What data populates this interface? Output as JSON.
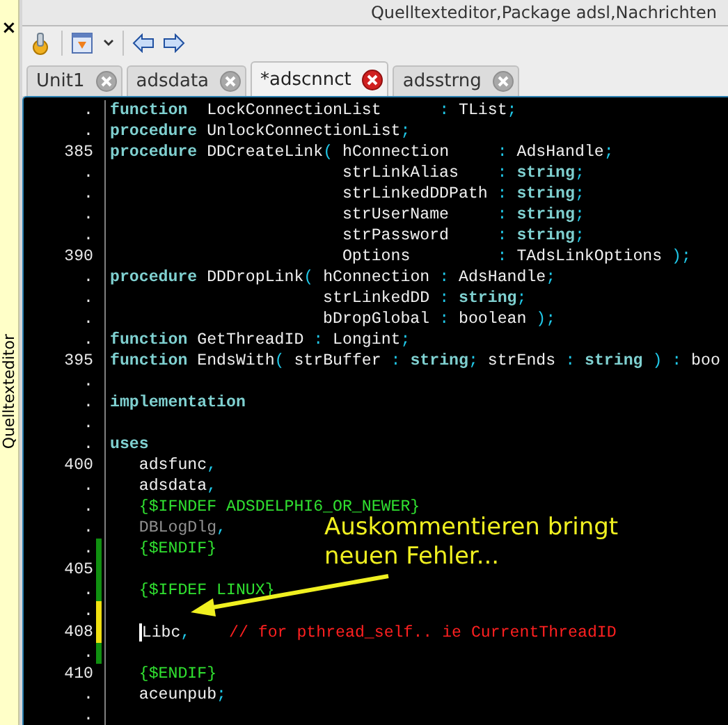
{
  "window": {
    "title": "Quelltexteditor,Package adsl,Nachrichten"
  },
  "dock": {
    "close": "×",
    "title": "Quelltexteditor"
  },
  "tabs": [
    {
      "label": "Unit1",
      "selected": false
    },
    {
      "label": "adsdata",
      "selected": false
    },
    {
      "label": "*adscnnct",
      "selected": true
    },
    {
      "label": "adsstrng",
      "selected": false
    }
  ],
  "code": {
    "lines": [
      {
        "number": ".",
        "tokens": [
          {
            "kind": "keyword",
            "text": "function"
          },
          {
            "kind": "text",
            "text": "  LockConnectionList      "
          },
          {
            "kind": "symbol",
            "text": ": "
          },
          {
            "kind": "text",
            "text": "TList"
          },
          {
            "kind": "symbol",
            "text": ";"
          }
        ]
      },
      {
        "number": ".",
        "tokens": [
          {
            "kind": "keyword",
            "text": "procedure"
          },
          {
            "kind": "text",
            "text": " UnlockConnectionList"
          },
          {
            "kind": "symbol",
            "text": ";"
          }
        ]
      },
      {
        "number": "385",
        "tokens": [
          {
            "kind": "keyword",
            "text": "procedure"
          },
          {
            "kind": "text",
            "text": " DDCreateLink"
          },
          {
            "kind": "symbol",
            "text": "("
          },
          {
            "kind": "text",
            "text": " hConnection     "
          },
          {
            "kind": "symbol",
            "text": ": "
          },
          {
            "kind": "text",
            "text": "AdsHandle"
          },
          {
            "kind": "symbol",
            "text": ";"
          }
        ]
      },
      {
        "number": ".",
        "tokens": [
          {
            "kind": "text",
            "text": "                        strLinkAlias    "
          },
          {
            "kind": "symbol",
            "text": ": "
          },
          {
            "kind": "keyword",
            "text": "string"
          },
          {
            "kind": "symbol",
            "text": ";"
          }
        ]
      },
      {
        "number": ".",
        "tokens": [
          {
            "kind": "text",
            "text": "                        strLinkedDDPath "
          },
          {
            "kind": "symbol",
            "text": ": "
          },
          {
            "kind": "keyword",
            "text": "string"
          },
          {
            "kind": "symbol",
            "text": ";"
          }
        ]
      },
      {
        "number": ".",
        "tokens": [
          {
            "kind": "text",
            "text": "                        strUserName     "
          },
          {
            "kind": "symbol",
            "text": ": "
          },
          {
            "kind": "keyword",
            "text": "string"
          },
          {
            "kind": "symbol",
            "text": ";"
          }
        ]
      },
      {
        "number": ".",
        "tokens": [
          {
            "kind": "text",
            "text": "                        strPassword     "
          },
          {
            "kind": "symbol",
            "text": ": "
          },
          {
            "kind": "keyword",
            "text": "string"
          },
          {
            "kind": "symbol",
            "text": ";"
          }
        ]
      },
      {
        "number": "390",
        "tokens": [
          {
            "kind": "text",
            "text": "                        Options         "
          },
          {
            "kind": "symbol",
            "text": ": "
          },
          {
            "kind": "text",
            "text": "TAdsLinkOptions "
          },
          {
            "kind": "symbol",
            "text": ");"
          }
        ]
      },
      {
        "number": ".",
        "tokens": [
          {
            "kind": "keyword",
            "text": "procedure"
          },
          {
            "kind": "text",
            "text": " DDDropLink"
          },
          {
            "kind": "symbol",
            "text": "("
          },
          {
            "kind": "text",
            "text": " hConnection "
          },
          {
            "kind": "symbol",
            "text": ": "
          },
          {
            "kind": "text",
            "text": "AdsHandle"
          },
          {
            "kind": "symbol",
            "text": ";"
          }
        ]
      },
      {
        "number": ".",
        "tokens": [
          {
            "kind": "text",
            "text": "                      strLinkedDD "
          },
          {
            "kind": "symbol",
            "text": ": "
          },
          {
            "kind": "keyword",
            "text": "string"
          },
          {
            "kind": "symbol",
            "text": ";"
          }
        ]
      },
      {
        "number": ".",
        "tokens": [
          {
            "kind": "text",
            "text": "                      bDropGlobal "
          },
          {
            "kind": "symbol",
            "text": ": "
          },
          {
            "kind": "text",
            "text": "boolean "
          },
          {
            "kind": "symbol",
            "text": ");"
          }
        ]
      },
      {
        "number": ".",
        "tokens": [
          {
            "kind": "keyword",
            "text": "function"
          },
          {
            "kind": "text",
            "text": " GetThreadID "
          },
          {
            "kind": "symbol",
            "text": ": "
          },
          {
            "kind": "text",
            "text": "Longint"
          },
          {
            "kind": "symbol",
            "text": ";"
          }
        ]
      },
      {
        "number": "395",
        "tokens": [
          {
            "kind": "keyword",
            "text": "function"
          },
          {
            "kind": "text",
            "text": " EndsWith"
          },
          {
            "kind": "symbol",
            "text": "( "
          },
          {
            "kind": "text",
            "text": "strBuffer "
          },
          {
            "kind": "symbol",
            "text": ": "
          },
          {
            "kind": "keyword",
            "text": "string"
          },
          {
            "kind": "symbol",
            "text": "; "
          },
          {
            "kind": "text",
            "text": "strEnds "
          },
          {
            "kind": "symbol",
            "text": ": "
          },
          {
            "kind": "keyword",
            "text": "string"
          },
          {
            "kind": "symbol",
            "text": " ) : "
          },
          {
            "kind": "text",
            "text": "boo"
          }
        ]
      },
      {
        "number": "."
      },
      {
        "number": ".",
        "tokens": [
          {
            "kind": "keyword",
            "text": "implementation"
          }
        ]
      },
      {
        "number": "."
      },
      {
        "number": ".",
        "tokens": [
          {
            "kind": "keyword",
            "text": "uses"
          }
        ]
      },
      {
        "number": "400",
        "tokens": [
          {
            "kind": "text",
            "text": "   adsfunc"
          },
          {
            "kind": "symbol",
            "text": ","
          }
        ]
      },
      {
        "number": ".",
        "tokens": [
          {
            "kind": "text",
            "text": "   adsdata"
          },
          {
            "kind": "symbol",
            "text": ","
          }
        ]
      },
      {
        "number": ".",
        "tokens": [
          {
            "kind": "directive",
            "text": "   {$IFNDEF ADSDELPHI6_OR_NEWER}"
          }
        ]
      },
      {
        "number": ".",
        "tokens": [
          {
            "kind": "disabled",
            "text": "   DBLogDlg"
          },
          {
            "kind": "symbol",
            "text": ","
          }
        ]
      },
      {
        "number": ".",
        "color": "#109010",
        "tokens": [
          {
            "kind": "directive",
            "text": "   {$ENDIF}"
          }
        ]
      },
      {
        "number": "405",
        "color": "#109010"
      },
      {
        "number": ".",
        "color": "#109010",
        "tokens": [
          {
            "kind": "directive",
            "text": "   {$IFDEF LINUX}"
          }
        ]
      },
      {
        "number": ".",
        "color": "#f0e010"
      },
      {
        "number": "408",
        "color": "#f0e010",
        "cursor": true,
        "tokens": [
          {
            "kind": "text",
            "text": "   Libc"
          },
          {
            "kind": "symbol",
            "text": ","
          },
          {
            "kind": "comment",
            "text": "    // for pthread_self.. ie CurrentThreadID"
          }
        ]
      },
      {
        "number": ".",
        "color": "#109010"
      },
      {
        "number": "410",
        "tokens": [
          {
            "kind": "directive",
            "text": "   {$ENDIF}"
          }
        ]
      },
      {
        "number": ".",
        "tokens": [
          {
            "kind": "text",
            "text": "   aceunpub"
          },
          {
            "kind": "symbol",
            "text": ";"
          }
        ]
      },
      {
        "number": "."
      }
    ]
  },
  "callout": {
    "text": "Auskommentieren bringt neuen Fehler..."
  }
}
